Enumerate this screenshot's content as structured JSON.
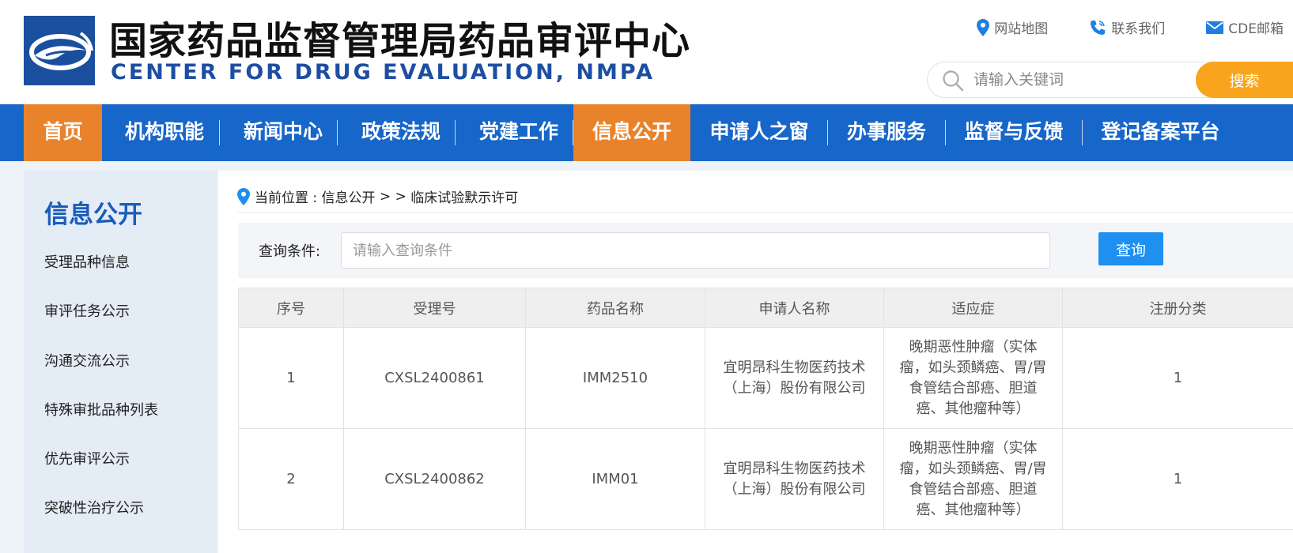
{
  "header": {
    "title_cn": "国家药品监督管理局药品审评中心",
    "title_en": "CENTER FOR DRUG EVALUATION, NMPA",
    "links": [
      {
        "label": "网站地图",
        "icon": "map-pin-icon"
      },
      {
        "label": "联系我们",
        "icon": "phone-icon"
      },
      {
        "label": "CDE邮箱",
        "icon": "mail-icon"
      }
    ],
    "search": {
      "placeholder": "请输入关键词",
      "button": "搜索"
    }
  },
  "nav": {
    "items": [
      {
        "label": "首页",
        "active": true
      },
      {
        "label": "机构职能",
        "active": false
      },
      {
        "label": "新闻中心",
        "active": false
      },
      {
        "label": "政策法规",
        "active": false
      },
      {
        "label": "党建工作",
        "active": false
      },
      {
        "label": "信息公开",
        "active": true
      },
      {
        "label": "申请人之窗",
        "active": false
      },
      {
        "label": "办事服务",
        "active": false
      },
      {
        "label": "监督与反馈",
        "active": false
      },
      {
        "label": "登记备案平台",
        "active": false
      }
    ]
  },
  "sidebar": {
    "title": "信息公开",
    "items": [
      {
        "label": "受理品种信息"
      },
      {
        "label": "审评任务公示"
      },
      {
        "label": "沟通交流公示"
      },
      {
        "label": "特殊审批品种列表"
      },
      {
        "label": "优先审评公示"
      },
      {
        "label": "突破性治疗公示"
      }
    ]
  },
  "breadcrumb": {
    "prefix": "当前位置 : ",
    "section": "信息公开",
    "separator": " > > ",
    "current": "临床试验默示许可"
  },
  "query": {
    "label": "查询条件:",
    "placeholder": "请输入查询条件",
    "button": "查询"
  },
  "table": {
    "columns": [
      "序号",
      "受理号",
      "药品名称",
      "申请人名称",
      "适应症",
      "注册分类"
    ],
    "rows": [
      [
        "1",
        "CXSL2400861",
        "IMM2510",
        "宜明昂科生物医药技术（上海）股份有限公司",
        "晚期恶性肿瘤（实体瘤，如头颈鳞癌、胃/胃食管结合部癌、胆道癌、其他瘤种等）",
        "1"
      ],
      [
        "2",
        "CXSL2400862",
        "IMM01",
        "宜明昂科生物医药技术（上海）股份有限公司",
        "晚期恶性肿瘤（实体瘤，如头颈鳞癌、胃/胃食管结合部癌、胆道癌、其他瘤种等）",
        "1"
      ]
    ]
  },
  "colors": {
    "nav_blue": "#1766c9",
    "nav_active_orange": "#e8832c",
    "search_orange": "#f8a51d",
    "title_blue": "#1d4ea3",
    "sidebar_title_blue": "#1b5cba",
    "query_button_blue": "#1e90f0"
  }
}
